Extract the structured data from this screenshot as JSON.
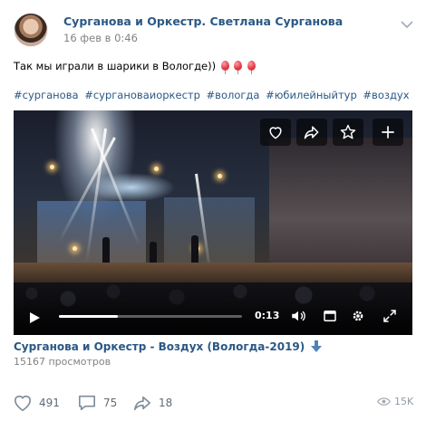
{
  "post": {
    "author": "Сурганова и Оркестр. Светлана Сурганова",
    "date": "16 фев в 0:46",
    "text": "Так мы играли в шарики в Вологде))",
    "hashtags": [
      "#сурганова",
      "#сургановаиоркестр",
      "#вологда",
      "#юбилейныйтур",
      "#воздух"
    ]
  },
  "video": {
    "time": "0:13",
    "progress_fraction": 0.32,
    "title": "Сурганова и Оркестр - Воздух (Вологда-2019)",
    "views": "15167 просмотров",
    "overlay_icons": [
      "heart-icon",
      "share-icon",
      "star-icon",
      "plus-icon"
    ],
    "control_icons": [
      "play-icon",
      "volume-icon",
      "miniplayer-icon",
      "settings-icon",
      "fullscreen-icon"
    ]
  },
  "actions": {
    "likes": "491",
    "comments": "75",
    "shares": "18",
    "views": "15K"
  },
  "colors": {
    "link": "#2a5885",
    "meta": "#828282",
    "action_icon": "#7f8c99"
  }
}
